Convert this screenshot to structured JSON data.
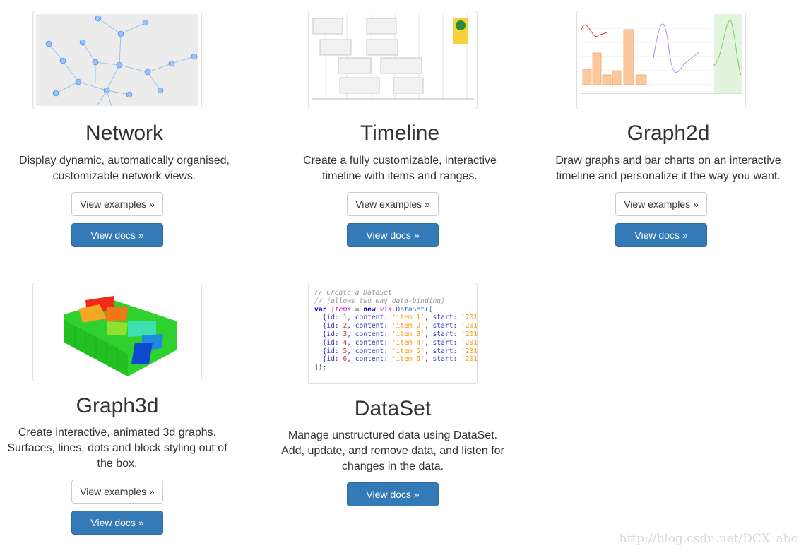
{
  "cards": [
    {
      "title": "Network",
      "desc": [
        "Display dynamic, automatically organised,",
        "customizable network views."
      ],
      "examples": "View examples »",
      "docs": "View docs »"
    },
    {
      "title": "Timeline",
      "desc": [
        "Create a fully customizable, interactive",
        "timeline with items and ranges."
      ],
      "examples": "View examples »",
      "docs": "View docs »"
    },
    {
      "title": "Graph2d",
      "desc": [
        "Draw graphs and bar charts on an interactive",
        "timeline and personalize it the way you want."
      ],
      "examples": "View examples »",
      "docs": "View docs »"
    },
    {
      "title": "Graph3d",
      "desc": [
        "Create interactive, animated 3d graphs.",
        "Surfaces, lines, dots and block styling out of",
        "the box."
      ],
      "examples": "View examples »",
      "docs": "View docs »"
    },
    {
      "title": "DataSet",
      "desc": [
        "Manage unstructured data using DataSet.",
        "Add, update, and remove data, and listen for",
        "changes in the data."
      ],
      "docs": "View docs »"
    }
  ],
  "code_lines": [
    [
      [
        "// Create a DataSet",
        "comment"
      ]
    ],
    [
      [
        "// (allows two way data-binding)",
        "comment"
      ]
    ],
    [
      [
        "var ",
        "kw"
      ],
      [
        "items",
        "var"
      ],
      [
        " = ",
        "plain"
      ],
      [
        "new ",
        "kw"
      ],
      [
        "vis",
        "var"
      ],
      [
        ".DataSet([",
        "fn"
      ]
    ],
    [
      [
        "  {id: ",
        "prop"
      ],
      [
        "1",
        "num"
      ],
      [
        ", content: ",
        "prop"
      ],
      [
        "'item 1'",
        "str"
      ],
      [
        ", start: ",
        "prop"
      ],
      [
        "'201",
        "str"
      ]
    ],
    [
      [
        "  {id: ",
        "prop"
      ],
      [
        "2",
        "num"
      ],
      [
        ", content: ",
        "prop"
      ],
      [
        "'item 2'",
        "str"
      ],
      [
        ", start: ",
        "prop"
      ],
      [
        "'201",
        "str"
      ]
    ],
    [
      [
        "  {id: ",
        "prop"
      ],
      [
        "3",
        "num"
      ],
      [
        ", content: ",
        "prop"
      ],
      [
        "'item 3'",
        "str"
      ],
      [
        ", start: ",
        "prop"
      ],
      [
        "'201",
        "str"
      ]
    ],
    [
      [
        "  {id: ",
        "prop"
      ],
      [
        "4",
        "num"
      ],
      [
        ", content: ",
        "prop"
      ],
      [
        "'item 4'",
        "str"
      ],
      [
        ", start: ",
        "prop"
      ],
      [
        "'201",
        "str"
      ]
    ],
    [
      [
        "  {id: ",
        "prop"
      ],
      [
        "5",
        "num"
      ],
      [
        ", content: ",
        "prop"
      ],
      [
        "'item 5'",
        "str"
      ],
      [
        ", start: ",
        "prop"
      ],
      [
        "'201",
        "str"
      ]
    ],
    [
      [
        "  {id: ",
        "prop"
      ],
      [
        "6",
        "num"
      ],
      [
        ", content: ",
        "prop"
      ],
      [
        "'item 6'",
        "str"
      ],
      [
        ", start: ",
        "prop"
      ],
      [
        "'201",
        "str"
      ]
    ],
    [
      [
        "]);",
        "plain"
      ]
    ]
  ],
  "code_colors": {
    "comment": "#999999",
    "kw": "#0000cc",
    "var": "#cc00cc",
    "fn": "#3366cc",
    "prop": "#3333cc",
    "num": "#dd3333",
    "str": "#ff9900",
    "plain": "#333333"
  },
  "colors": {
    "primary": "#337ab7",
    "node": "#97c2fc",
    "bar": "#fbc79c"
  },
  "watermark": "http://blog.csdn.net/DCX_abc"
}
